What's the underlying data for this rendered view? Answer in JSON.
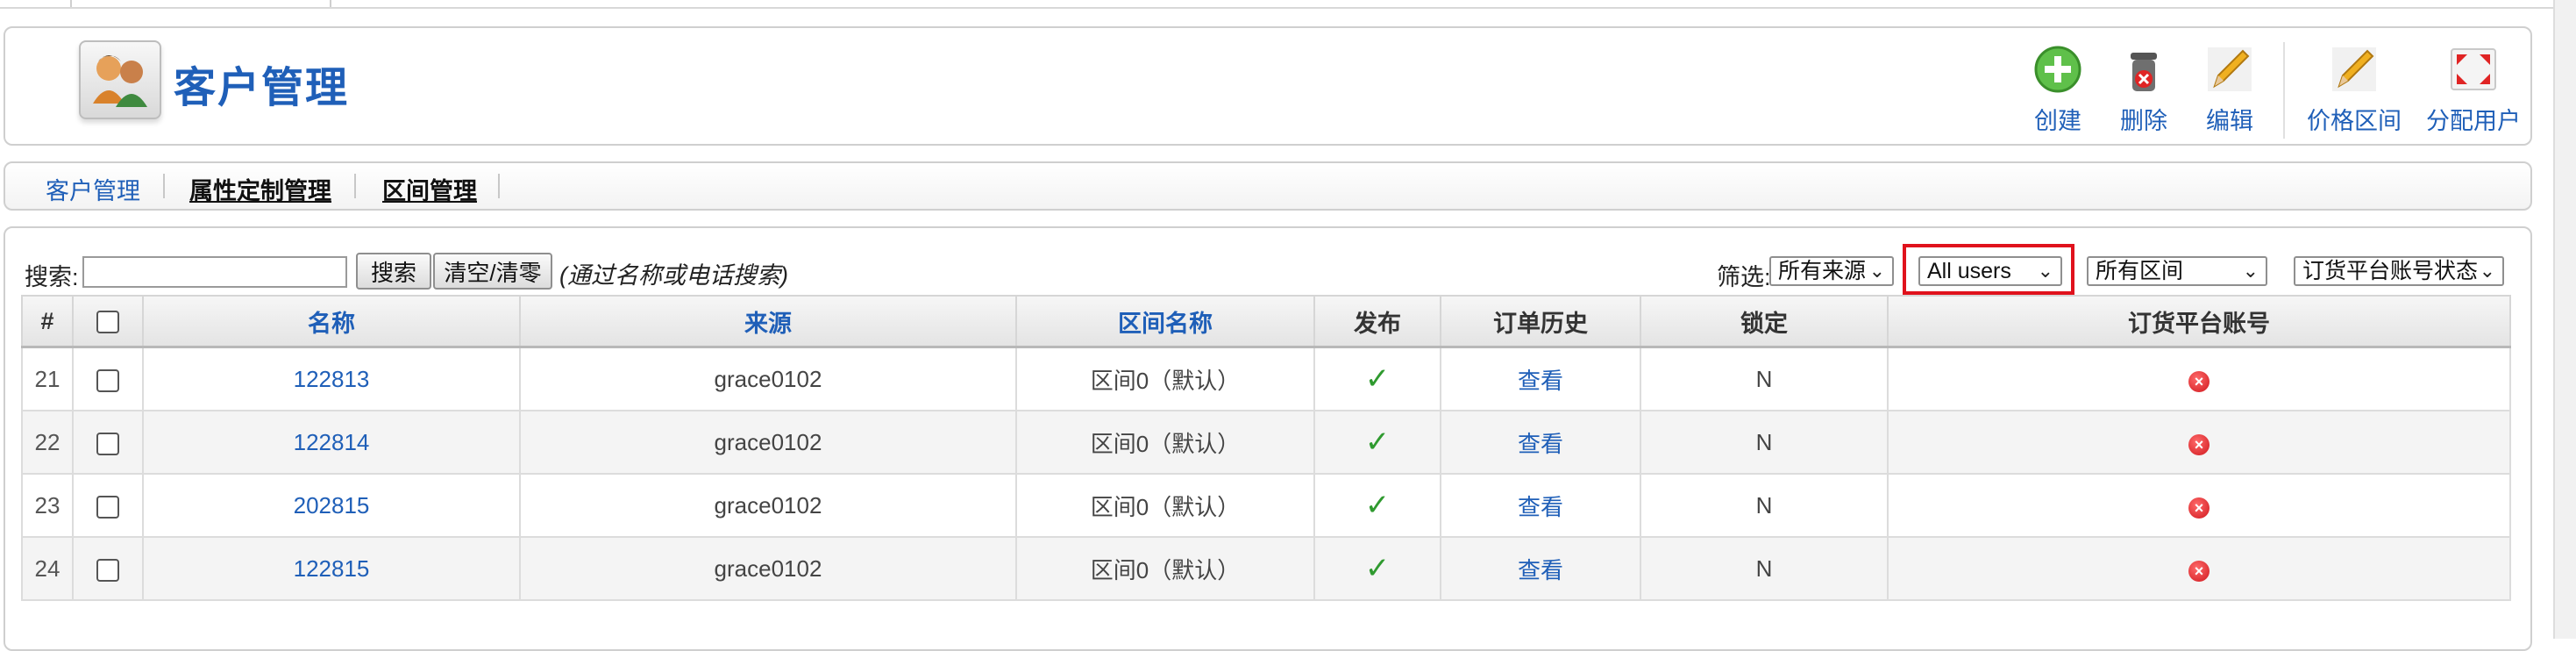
{
  "header": {
    "title": "客户管理",
    "toolbar": [
      {
        "key": "create",
        "label": "创建",
        "icon": "plus-circle-icon"
      },
      {
        "key": "delete",
        "label": "删除",
        "icon": "trash-can-icon"
      },
      {
        "key": "edit",
        "label": "编辑",
        "icon": "pencil-icon"
      },
      {
        "key": "price_range",
        "label": "价格区间",
        "icon": "pencil-icon"
      },
      {
        "key": "assign_user",
        "label": "分配用户",
        "icon": "expand-arrows-icon"
      }
    ]
  },
  "subtabs": [
    {
      "label": "客户管理",
      "active": true
    },
    {
      "label": "属性定制管理",
      "active": false
    },
    {
      "label": "区间管理",
      "active": false
    }
  ],
  "search": {
    "label": "搜索:",
    "value": "",
    "search_button": "搜索",
    "clear_button": "清空/清零",
    "hint": "(通过名称或电话搜索)"
  },
  "filters": {
    "label": "筛选:",
    "source": "所有来源",
    "users": "All users",
    "range": "所有区间",
    "account_status": "订货平台账号状态"
  },
  "table": {
    "columns": [
      "#",
      "",
      "名称",
      "来源",
      "区间名称",
      "发布",
      "订单历史",
      "锁定",
      "订货平台账号"
    ],
    "rows": [
      {
        "num": "21",
        "name": "122813",
        "source": "grace0102",
        "range": "区间0（默认）",
        "view": "查看",
        "locked": "N"
      },
      {
        "num": "22",
        "name": "122814",
        "source": "grace0102",
        "range": "区间0（默认）",
        "view": "查看",
        "locked": "N"
      },
      {
        "num": "23",
        "name": "202815",
        "source": "grace0102",
        "range": "区间0（默认）",
        "view": "查看",
        "locked": "N"
      },
      {
        "num": "24",
        "name": "122815",
        "source": "grace0102",
        "range": "区间0（默认）",
        "view": "查看",
        "locked": "N"
      }
    ]
  },
  "colors": {
    "link": "#1f5fb8",
    "highlight": "#e0121c",
    "check": "#2f9a2f",
    "error": "#d0181e"
  }
}
